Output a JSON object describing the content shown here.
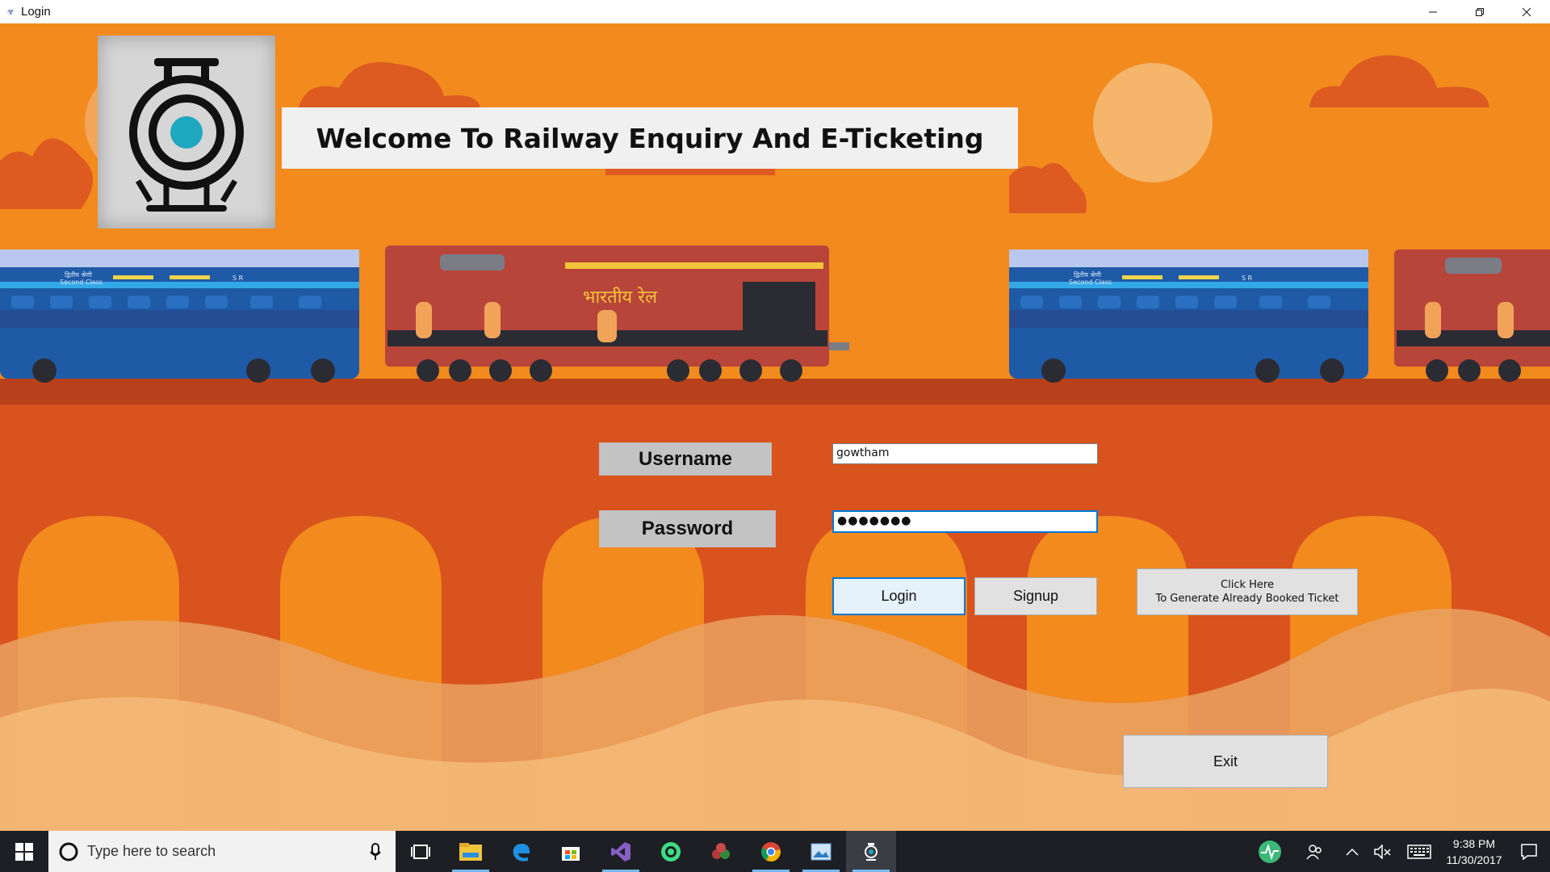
{
  "window": {
    "title": "Login",
    "icon": "train-logo-icon",
    "controls": [
      "minimize-icon",
      "restore-icon",
      "close-icon"
    ]
  },
  "header": {
    "welcome_text": "Welcome To Railway Enquiry And E-Ticketing"
  },
  "scene": {
    "coach_text_hindi": "द्वितीय श्रेणी",
    "coach_text_english": "Second Class",
    "coach_code": "S R",
    "engine_text": "भारतीय रेल"
  },
  "form": {
    "username_label": "Username",
    "username_value": "gowtham",
    "password_label": "Password",
    "password_value": "●●●●●●●",
    "login_label": "Login",
    "signup_label": "Signup",
    "ticket_line1": "Click Here",
    "ticket_line2": "To Generate Already Booked Ticket",
    "exit_label": "Exit"
  },
  "taskbar": {
    "search_placeholder": "Type here to search",
    "apps": [
      "task-view-icon",
      "file-explorer-icon",
      "edge-icon",
      "store-icon",
      "visual-studio-icon",
      "android-studio-icon",
      "davinci-icon",
      "chrome-icon",
      "photos-icon",
      "login-app-icon"
    ],
    "time": "9:38 PM",
    "date": "11/30/2017"
  },
  "colors": {
    "sky": "#f28a1e",
    "ground": "#d9531e",
    "accent": "#0078d7"
  }
}
